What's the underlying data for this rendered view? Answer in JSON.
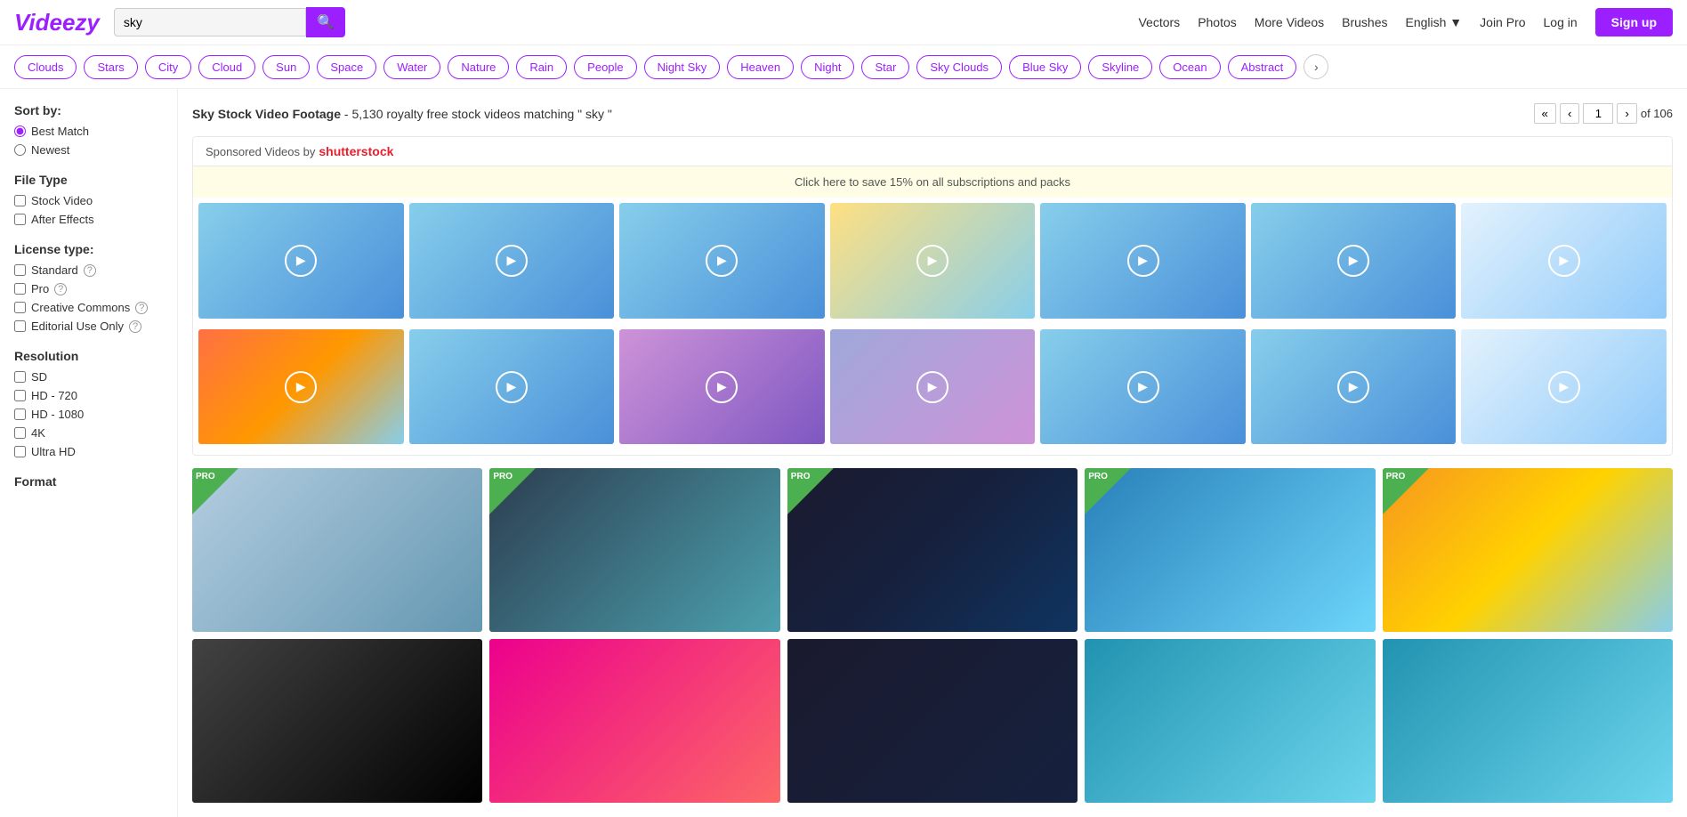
{
  "header": {
    "logo": "Videezy",
    "search_placeholder": "sky",
    "search_value": "sky",
    "nav": {
      "vectors": "Vectors",
      "photos": "Photos",
      "more_videos": "More Videos",
      "brushes": "Brushes",
      "language": "English",
      "join_pro": "Join Pro",
      "login": "Log in",
      "signup": "Sign up"
    }
  },
  "tags": {
    "items": [
      "Clouds",
      "Stars",
      "City",
      "Cloud",
      "Sun",
      "Space",
      "Water",
      "Nature",
      "Rain",
      "People",
      "Night Sky",
      "Heaven",
      "Night",
      "Star",
      "Sky Clouds",
      "Blue Sky",
      "Skyline",
      "Ocean",
      "Abstract"
    ],
    "next_label": "›"
  },
  "sidebar": {
    "sort_label": "Sort by:",
    "sort_options": [
      {
        "id": "best-match",
        "label": "Best Match",
        "checked": true
      },
      {
        "id": "newest",
        "label": "Newest",
        "checked": false
      }
    ],
    "file_type_label": "File Type",
    "file_types": [
      {
        "id": "stock-video",
        "label": "Stock Video"
      },
      {
        "id": "after-effects",
        "label": "After Effects"
      }
    ],
    "license_label": "License type:",
    "licenses": [
      {
        "id": "standard",
        "label": "Standard"
      },
      {
        "id": "pro",
        "label": "Pro"
      },
      {
        "id": "creative-commons",
        "label": "Creative Commons"
      },
      {
        "id": "editorial",
        "label": "Editorial Use Only"
      }
    ],
    "resolution_label": "Resolution",
    "resolutions": [
      {
        "id": "sd",
        "label": "SD"
      },
      {
        "id": "hd720",
        "label": "HD - 720"
      },
      {
        "id": "hd1080",
        "label": "HD - 1080"
      },
      {
        "id": "4k",
        "label": "4K"
      },
      {
        "id": "ultra-hd",
        "label": "Ultra HD"
      }
    ],
    "format_label": "Format"
  },
  "results": {
    "title": "Sky Stock Video Footage",
    "count": "5,130",
    "query": "sky",
    "current_page": "1",
    "total_pages": "of 106",
    "sponsored_text": "Sponsored Videos by",
    "shutterstock": "shutterstock",
    "promo": "Click here to save 15% on all subscriptions and packs"
  }
}
